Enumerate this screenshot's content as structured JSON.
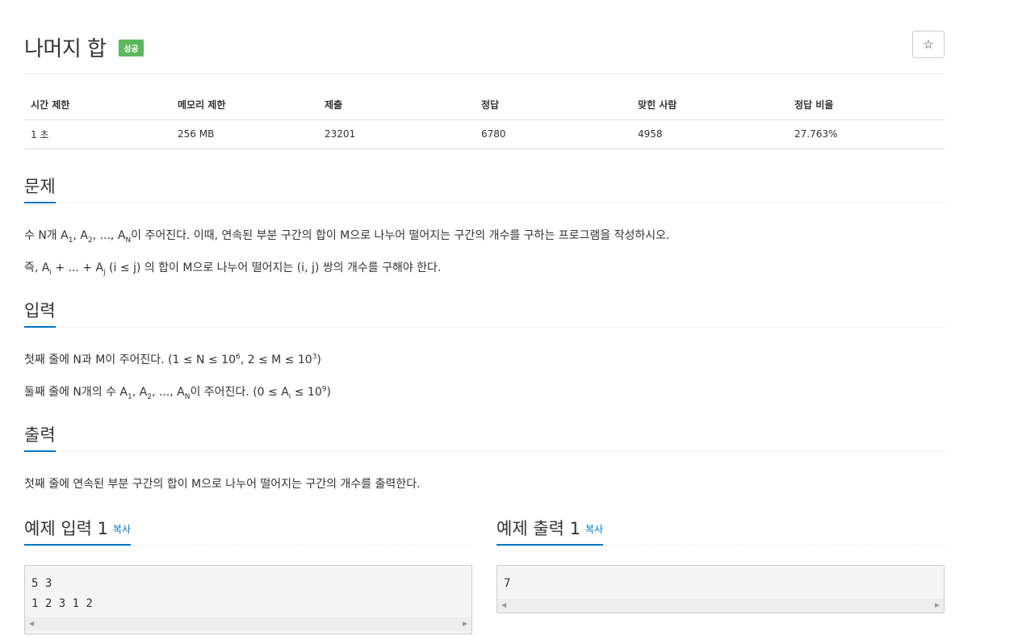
{
  "problem": {
    "title": "나머지 합",
    "badge": "성공",
    "star_icon": "☆"
  },
  "stats": {
    "headers": [
      "시간 제한",
      "메모리 제한",
      "제출",
      "정답",
      "맞힌 사람",
      "정답 비율"
    ],
    "values": [
      "1 초",
      "256 MB",
      "23201",
      "6780",
      "4958",
      "27.763%"
    ]
  },
  "sections": {
    "description": "문제",
    "input": "입력",
    "output": "출력"
  },
  "description": {
    "line1_a": "수 N개 A",
    "line1_sub1": "1",
    "line1_b": ", A",
    "line1_sub2": "2",
    "line1_c": ", ..., A",
    "line1_subN": "N",
    "line1_d": "이 주어진다. 이때, 연속된 부분 구간의 합이 M으로 나누어 떨어지는 구간의 개수를 구하는 프로그램을 작성하시오.",
    "line2_a": "즉, A",
    "line2_subi": "i",
    "line2_b": " + ... + A",
    "line2_subj": "j",
    "line2_c": " (i ≤ j) 의 합이 M으로 나누어 떨어지는 (i, j) 쌍의 개수를 구해야 한다."
  },
  "input_desc": {
    "line1_a": "첫째 줄에 N과 M이 주어진다. (1 ≤ N ≤ 10",
    "line1_sup1": "6",
    "line1_b": ", 2 ≤ M ≤ 10",
    "line1_sup2": "3",
    "line1_c": ")",
    "line2_a": "둘째 줄에 N개의 수 A",
    "line2_sub1": "1",
    "line2_b": ", A",
    "line2_sub2": "2",
    "line2_c": ", ..., A",
    "line2_subN": "N",
    "line2_d": "이 주어진다. (0 ≤ A",
    "line2_subi": "i",
    "line2_e": " ≤ 10",
    "line2_sup": "9",
    "line2_f": ")"
  },
  "output_desc": {
    "line1": "첫째 줄에 연속된 부분 구간의 합이 M으로 나누어 떨어지는 구간의 개수를 출력한다."
  },
  "samples": {
    "input_title": "예제 입력 1",
    "output_title": "예제 출력 1",
    "copy_label": "복사",
    "input_text": "5 3\n1 2 3 1 2",
    "output_text": "7",
    "scroll_left": "◀",
    "scroll_right": "▶"
  }
}
